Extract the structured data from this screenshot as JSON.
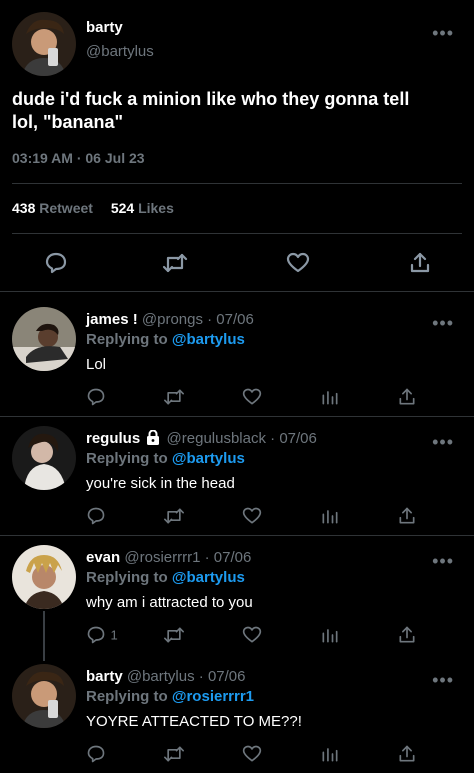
{
  "main_tweet": {
    "display_name": "barty",
    "handle": "@bartylus",
    "text_line1": "dude i'd fuck a minion like who they gonna tell",
    "text_line2": "lol, \"banana\"",
    "timestamp": "03:19 AM · 06 Jul 23",
    "retweets_count": "438",
    "retweets_label": "Retweet",
    "likes_count": "524",
    "likes_label": "Likes"
  },
  "replies": [
    {
      "name": "james !",
      "handle": "@prongs",
      "date": "· 07/06",
      "replying_prefix": "Replying to",
      "replying_to": "@bartylus",
      "text": "Lol",
      "reply_count": ""
    },
    {
      "name": "regulus",
      "handle": "@regulusblack",
      "date": "· 07/06",
      "replying_prefix": "Replying to",
      "replying_to": "@bartylus",
      "text": "you're sick in the head",
      "reply_count": ""
    },
    {
      "name": "evan",
      "handle": "@rosierrrr1",
      "date": "· 07/06",
      "replying_prefix": "Replying to",
      "replying_to": "@bartylus",
      "text": "why am i attracted to you",
      "reply_count": "1"
    },
    {
      "name": "barty",
      "handle": "@bartylus",
      "date": "· 07/06",
      "replying_prefix": "Replying to",
      "replying_to": "@rosierrrr1",
      "text": "YOYRE ATTEACTED TO ME??!",
      "reply_count": ""
    }
  ],
  "icons": {
    "more": "more-options-icon",
    "reply": "reply-icon",
    "retweet": "retweet-icon",
    "like": "heart-icon",
    "analytics": "analytics-icon",
    "share": "share-icon",
    "lock": "lock-icon"
  },
  "colors": {
    "background": "#000000",
    "muted": "#6e767d",
    "link": "#1d9bf0",
    "divider": "#2f3336"
  }
}
